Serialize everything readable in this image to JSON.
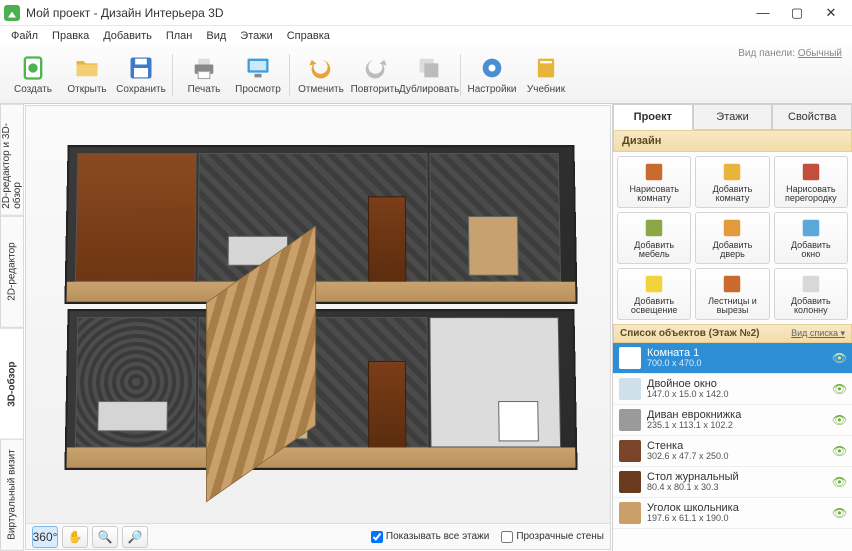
{
  "window": {
    "title": "Мой проект - Дизайн Интерьера 3D",
    "panel_hint_label": "Вид панели:",
    "panel_hint_value": "Обычный"
  },
  "menu": [
    "Файл",
    "Правка",
    "Добавить",
    "План",
    "Вид",
    "Этажи",
    "Справка"
  ],
  "toolbar": [
    {
      "id": "new",
      "label": "Создать",
      "icon": "#4fb44f",
      "shape": "doc"
    },
    {
      "id": "open",
      "label": "Открыть",
      "icon": "#e9b43a",
      "shape": "folder"
    },
    {
      "id": "save",
      "label": "Сохранить",
      "icon": "#3f79c9",
      "shape": "floppy"
    },
    {
      "sep": true
    },
    {
      "id": "print",
      "label": "Печать",
      "icon": "#888",
      "shape": "printer"
    },
    {
      "id": "preview",
      "label": "Просмотр",
      "icon": "#3c9fe0",
      "shape": "monitor"
    },
    {
      "sep": true
    },
    {
      "id": "undo",
      "label": "Отменить",
      "icon": "#e8a23c",
      "shape": "undo"
    },
    {
      "id": "redo",
      "label": "Повторить",
      "icon": "#bcbcbc",
      "shape": "redo"
    },
    {
      "id": "dup",
      "label": "Дублировать",
      "icon": "#bcbcbc",
      "shape": "dup"
    },
    {
      "sep": true
    },
    {
      "id": "settings",
      "label": "Настройки",
      "icon": "#4a8fd6",
      "shape": "gear"
    },
    {
      "id": "tutorial",
      "label": "Учебник",
      "icon": "#e9b43a",
      "shape": "book"
    }
  ],
  "vtabs": [
    {
      "id": "combo",
      "label": "2D-редактор и 3D-обзор"
    },
    {
      "id": "2d",
      "label": "2D-редактор"
    },
    {
      "id": "3d",
      "label": "3D-обзор",
      "active": true
    },
    {
      "id": "virtual",
      "label": "Виртуальный визит"
    }
  ],
  "bottombar": {
    "tools": [
      {
        "id": "360",
        "label": "360°",
        "active": true
      },
      {
        "id": "pan",
        "label": "✋"
      },
      {
        "id": "zoomin",
        "label": "🔍"
      },
      {
        "id": "zoomout",
        "label": "🔎"
      }
    ],
    "check_all_floors": "Показывать все этажи",
    "check_all_floors_val": true,
    "check_transparent": "Прозрачные стены",
    "check_transparent_val": false
  },
  "rtabs": [
    {
      "id": "project",
      "label": "Проект",
      "active": true
    },
    {
      "id": "floors",
      "label": "Этажи"
    },
    {
      "id": "props",
      "label": "Свойства"
    }
  ],
  "design_header": "Дизайн",
  "design_tools": [
    {
      "id": "draw-room",
      "label": "Нарисовать\nкомнату",
      "color": "#c96a2f"
    },
    {
      "id": "add-room",
      "label": "Добавить\nкомнату",
      "color": "#e9b43a"
    },
    {
      "id": "draw-partition",
      "label": "Нарисовать\nперегородку",
      "color": "#c14f3c"
    },
    {
      "id": "add-furniture",
      "label": "Добавить\nмебель",
      "color": "#8aa84a"
    },
    {
      "id": "add-door",
      "label": "Добавить\nдверь",
      "color": "#e29a3c"
    },
    {
      "id": "add-window",
      "label": "Добавить\nокно",
      "color": "#5ba8db"
    },
    {
      "id": "add-light",
      "label": "Добавить\nосвещение",
      "color": "#f2d33c"
    },
    {
      "id": "stairs-cut",
      "label": "Лестницы и\nвырезы",
      "color": "#c96a2f"
    },
    {
      "id": "add-column",
      "label": "Добавить\nколонну",
      "color": "#d8d8d8"
    }
  ],
  "objects_header": "Список объектов (Этаж №2)",
  "objects_view": "Вид списка",
  "objects": [
    {
      "id": "room1",
      "name": "Комната 1",
      "dim": "700.0 x 470.0",
      "sel": true,
      "icon": "#fff"
    },
    {
      "id": "window",
      "name": "Двойное окно",
      "dim": "147.0 x 15.0 x 142.0",
      "icon": "#cfe0ea"
    },
    {
      "id": "sofa",
      "name": "Диван еврокнижка",
      "dim": "235.1 x 113.1 x 102.2",
      "icon": "#9a9a9a"
    },
    {
      "id": "wall-unit",
      "name": "Стенка",
      "dim": "302.6 x 47.7 x 250.0",
      "icon": "#7a4428"
    },
    {
      "id": "coffee-table",
      "name": "Стол журнальный",
      "dim": "80.4 x 80.1 x 30.3",
      "icon": "#6a3a1e"
    },
    {
      "id": "kids-desk",
      "name": "Уголок школьника",
      "dim": "197.6 x 61.1 x 190.0",
      "icon": "#caa068"
    }
  ]
}
